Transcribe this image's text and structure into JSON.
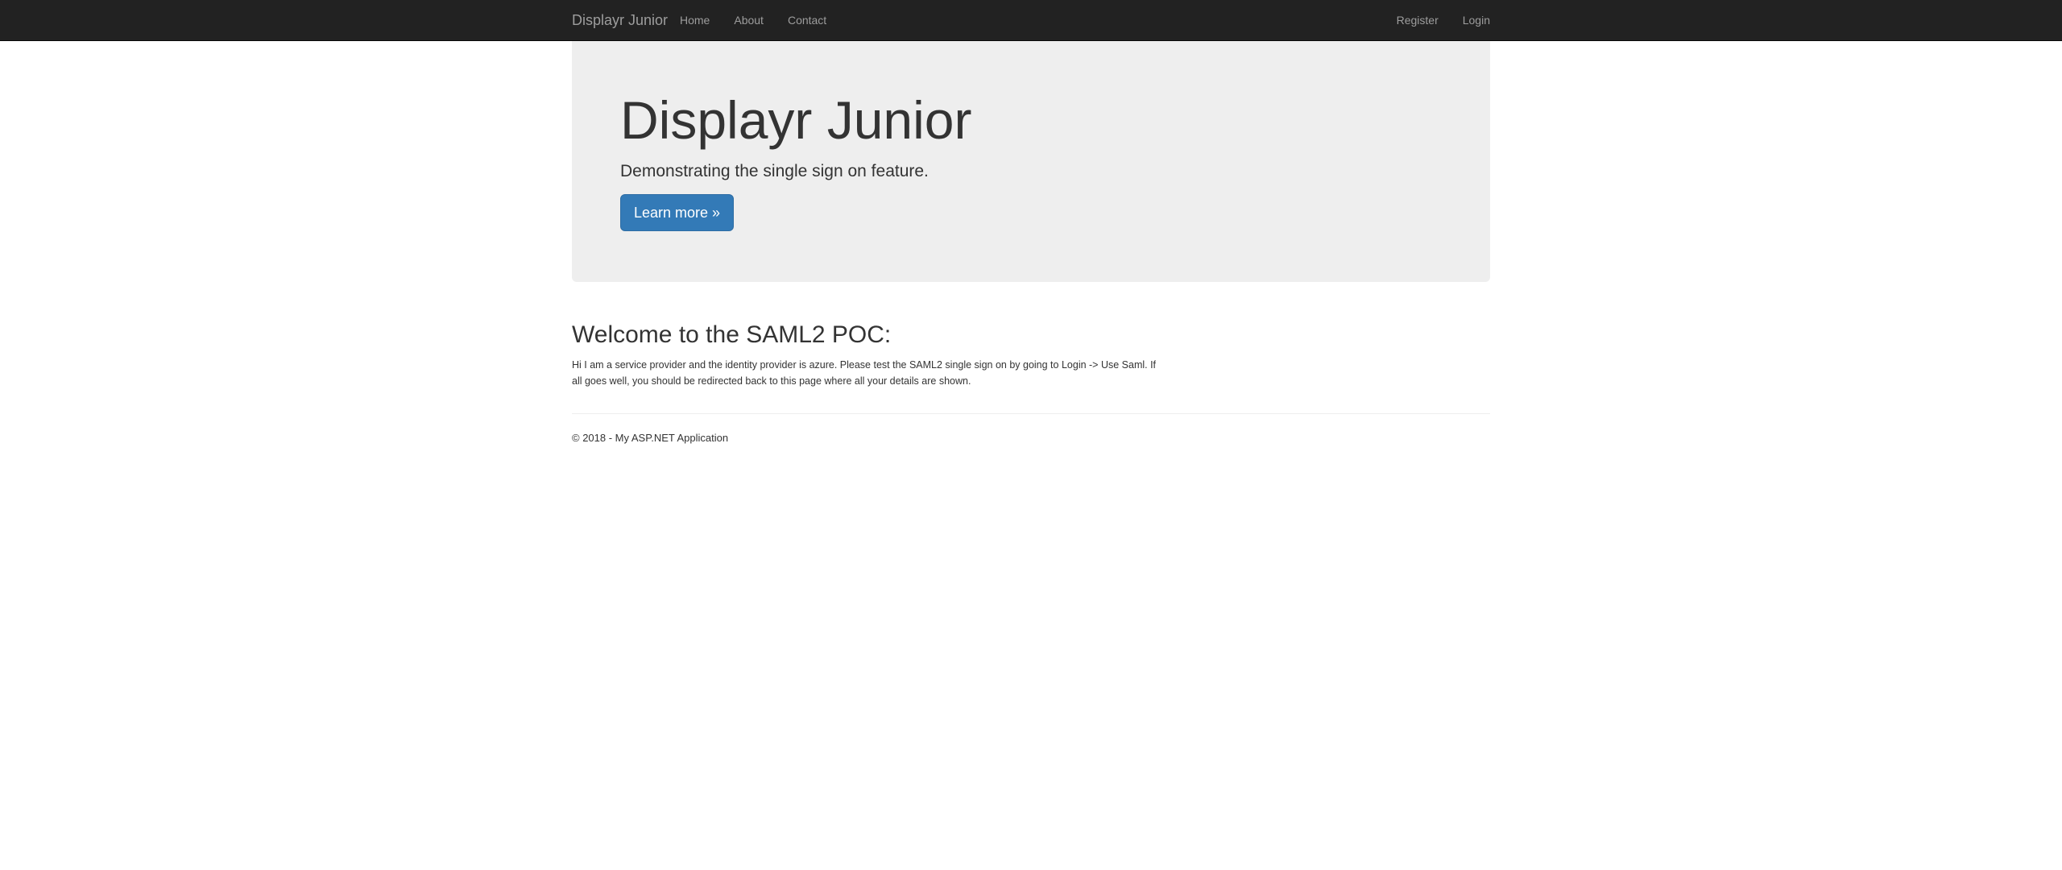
{
  "navbar": {
    "brand": "Displayr Junior",
    "left_links": [
      {
        "label": "Home"
      },
      {
        "label": "About"
      },
      {
        "label": "Contact"
      }
    ],
    "right_links": [
      {
        "label": "Register"
      },
      {
        "label": "Login"
      }
    ]
  },
  "jumbotron": {
    "title": "Displayr Junior",
    "lead": "Demonstrating the single sign on feature.",
    "button_label": "Learn more »"
  },
  "main": {
    "heading": "Welcome to the SAML2 POC:",
    "body": "Hi I am a service provider and the identity provider is azure. Please test the SAML2 single sign on by going to Login -> Use Saml. If all goes well, you should be redirected back to this page where all your details are shown."
  },
  "footer": {
    "text": "© 2018 - My ASP.NET Application"
  },
  "colors": {
    "navbar_bg": "#222222",
    "nav_text": "#9d9d9d",
    "jumbotron_bg": "#eeeeee",
    "primary": "#337ab7",
    "text": "#333333"
  }
}
